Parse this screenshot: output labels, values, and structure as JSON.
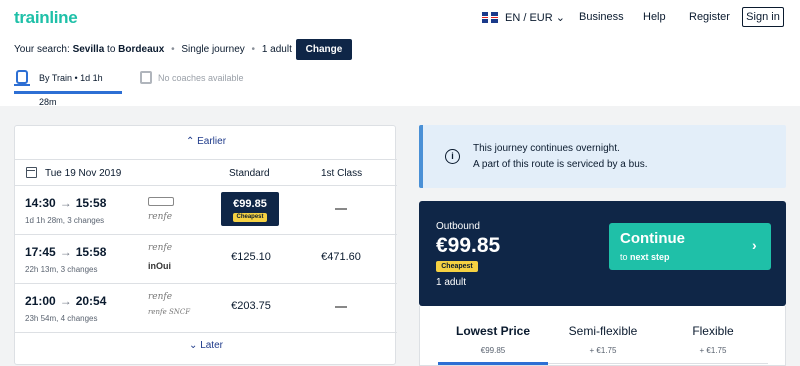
{
  "brand": {
    "logo": "trainline"
  },
  "header": {
    "lang": "EN / EUR",
    "business": "Business",
    "help": "Help",
    "register": "Register",
    "signin": "Sign in"
  },
  "search": {
    "prefix": "Your search:",
    "from": "Sevilla",
    "to_word": "to",
    "to": "Bordeaux",
    "journey": "Single journey",
    "passengers": "1 adult",
    "change": "Change"
  },
  "tabs": {
    "train": "By Train • 1d 1h 28m",
    "coach": "No coaches available"
  },
  "results": {
    "earlier": "Earlier",
    "later": "Later",
    "date": "Tue 19 Nov 2019",
    "col_standard": "Standard",
    "col_first": "1st Class",
    "rows": [
      {
        "dep": "14:30",
        "arr": "15:58",
        "meta": "1d 1h 28m, 3 changes",
        "op1": "renfe",
        "standard": "€99.85",
        "badge": "Cheapest",
        "first": ""
      },
      {
        "dep": "17:45",
        "arr": "15:58",
        "meta": "22h 13m, 3 changes",
        "op1": "renfe",
        "op2": "inOui",
        "standard": "€125.10",
        "first": "€471.60"
      },
      {
        "dep": "21:00",
        "arr": "20:54",
        "meta": "23h 54m, 4 changes",
        "op1": "renfe",
        "op2": "renfe SNCF",
        "standard": "€203.75",
        "first": ""
      }
    ]
  },
  "notice": {
    "line1": "This journey continues overnight.",
    "line2": "A part of this route is serviced by a bus."
  },
  "outbound": {
    "label": "Outbound",
    "price": "€99.85",
    "badge": "Cheapest",
    "passengers": "1 adult",
    "continue": "Continue",
    "continue_sub_prefix": "to",
    "continue_sub_bold": "next step"
  },
  "fares": [
    {
      "name": "Lowest Price",
      "price": "€99.85"
    },
    {
      "name": "Semi-flexible",
      "price": "+ €1.75"
    },
    {
      "name": "Flexible",
      "price": "+ €1.75"
    }
  ],
  "colors": {
    "brand": "#1fc0a8",
    "navy": "#0f2647",
    "badge": "#f5d142",
    "accent_blue": "#2d6fd4"
  }
}
